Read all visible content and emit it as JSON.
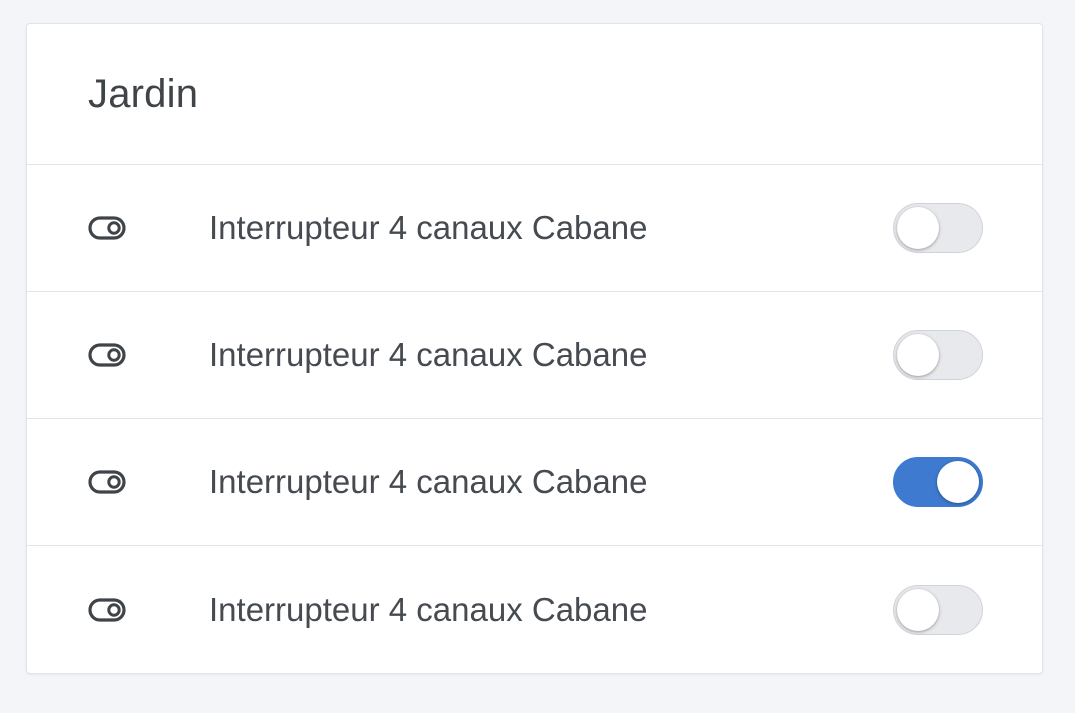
{
  "card": {
    "title": "Jardin"
  },
  "rows": [
    {
      "label": "Interrupteur 4 canaux Cabane",
      "icon": "toggle-switch-icon",
      "state": "off"
    },
    {
      "label": "Interrupteur 4 canaux Cabane",
      "icon": "toggle-switch-icon",
      "state": "off"
    },
    {
      "label": "Interrupteur 4 canaux Cabane",
      "icon": "toggle-switch-icon",
      "state": "on"
    },
    {
      "label": "Interrupteur 4 canaux Cabane",
      "icon": "toggle-switch-icon",
      "state": "off"
    }
  ],
  "colors": {
    "accent": "#3d7ad0",
    "text": "#464b51",
    "background": "#f4f5f9"
  }
}
